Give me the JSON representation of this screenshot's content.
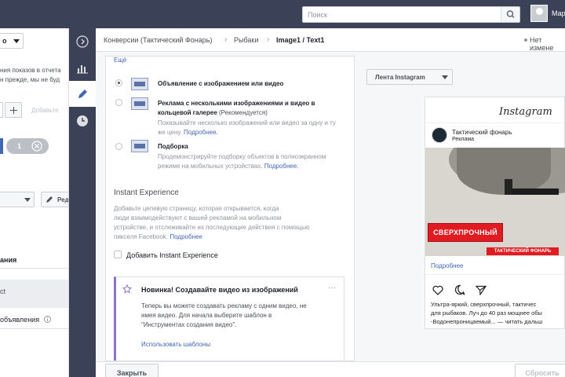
{
  "topbar": {
    "search_placeholder": "Поиск",
    "user_name": "Мар"
  },
  "left_panel": {
    "dropdown_label": "о",
    "notice_line1": "ния показов в отчета",
    "notice_line2": "н прежде, мы не буд",
    "add_label": "Добавьте",
    "pill_count": "1",
    "edit_label": "Ред",
    "col_header": "ания",
    "row1": "ct",
    "row2": "объявления"
  },
  "breadcrumb": {
    "items": [
      "Конверсии (Тактический Фонарь)",
      "Рыбаки",
      "Image1 / Text1"
    ],
    "no_changes": "Нет измене"
  },
  "format": {
    "more_link": "Ещё",
    "options": [
      {
        "title": "Объявление с изображением или видео",
        "desc": [],
        "link": ""
      },
      {
        "title": "Реклама с несколькими изображениями и видео в кольцевой галерее",
        "title_suffix": " (Рекомендуется)",
        "desc": [
          "Показывайте несколько изображений или видео за одну и ту",
          "же цену."
        ],
        "link": "Подробнее."
      },
      {
        "title": "Подборка",
        "desc": [
          "Продемонстрируйте подборку объектов в полноэкранном",
          "режиме на мобильных устройствах."
        ],
        "link": "Подробнее."
      }
    ],
    "instant": {
      "heading": "Instant Experience",
      "desc": [
        "Добавьте целевую страницу, которая открывается, когда",
        "люди взаимодействуют с вашей рекламой на мобильном",
        "устройстве, и отслеживайте их последующие действия с помощью",
        "пикселя Facebook."
      ],
      "link": "Подробнее",
      "checkbox_label": "Добавить Instant Experience"
    },
    "promo": {
      "title": "Новинка! Создавайте видео из изображений",
      "desc": [
        "Теперь вы можете создавать рекламу с одним видео, не",
        "имея видео. Для начала выберите шаблон в",
        "\"Инструментах создания видео\"."
      ],
      "link": "Использовать шаблоны",
      "more": "···"
    }
  },
  "preview": {
    "placement": "Лента Instagram",
    "logo": "Instagram",
    "account": "Тактический фонарь",
    "sponsored": "Реклама",
    "banner": "СВЕРХПРОЧНЫЙ",
    "brand_tag": "ТАКТИЧЕСКИЙ ФОНАРЬ",
    "cta": "Подробнее",
    "caption": [
      "Ультра-яркий, сверхпрочный, тактичес",
      "для рыбаков. Луч до 40 раз мощнее обы",
      "-Водонепроницаемый... — читать дальш"
    ]
  },
  "footer": {
    "close": "Закрыть",
    "reset": "Сбросить"
  }
}
